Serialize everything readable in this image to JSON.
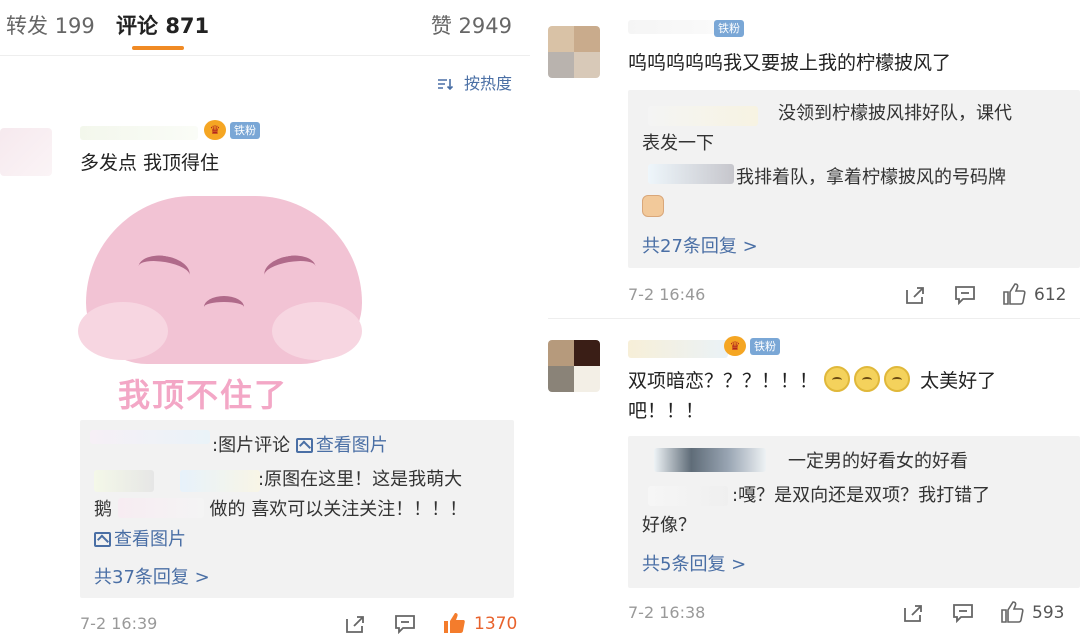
{
  "tabs": {
    "reposts_label": "转发",
    "reposts_count": "199",
    "comments_label": "评论",
    "comments_count": "871",
    "likes_label": "赞",
    "likes_count": "2949"
  },
  "sort": {
    "label": "按热度"
  },
  "badges": {
    "fan": "铁粉"
  },
  "left_comment": {
    "text": "多发点 我顶得住",
    "sticker_caption": "我顶不住了",
    "replies": {
      "line1_suffix": ":图片评论",
      "line1_link": "查看图片",
      "line2": ":原图在这里！这是我萌大",
      "line3_a": "鹅",
      "line3_b": "做的 喜欢可以关注关注！！！！",
      "line4_link": "查看图片",
      "more": "共37条回复 >"
    },
    "time": "7-2 16:39",
    "likes": "1370"
  },
  "right_comment_1": {
    "text": "呜呜呜呜呜我又要披上我的柠檬披风了",
    "replies": {
      "line1": "没领到柠檬披风排好队，课代",
      "line2": "表发一下",
      "line3": "我排着队，拿着柠檬披风的号码牌",
      "more": "共27条回复 >"
    },
    "time": "7-2 16:46",
    "likes": "612"
  },
  "right_comment_2": {
    "text_a": "双项暗恋？？？！！！",
    "text_b": "太美好了",
    "text_c": "吧！！！",
    "replies": {
      "line1": "一定男的好看女的好看",
      "line2": ":嘎？是双向还是双项？我打错了",
      "line3": "好像？",
      "more": "共5条回复 >"
    },
    "time": "7-2 16:38",
    "likes": "593"
  },
  "colors": {
    "accent": "#f08a24",
    "link": "#4a6fa5",
    "hot_like": "#e8622c"
  },
  "icons": [
    "sort-icon",
    "crown-icon",
    "image-icon",
    "share-icon",
    "comment-icon",
    "like-icon",
    "lemon-emoji-icon",
    "fist-emoji-icon"
  ]
}
